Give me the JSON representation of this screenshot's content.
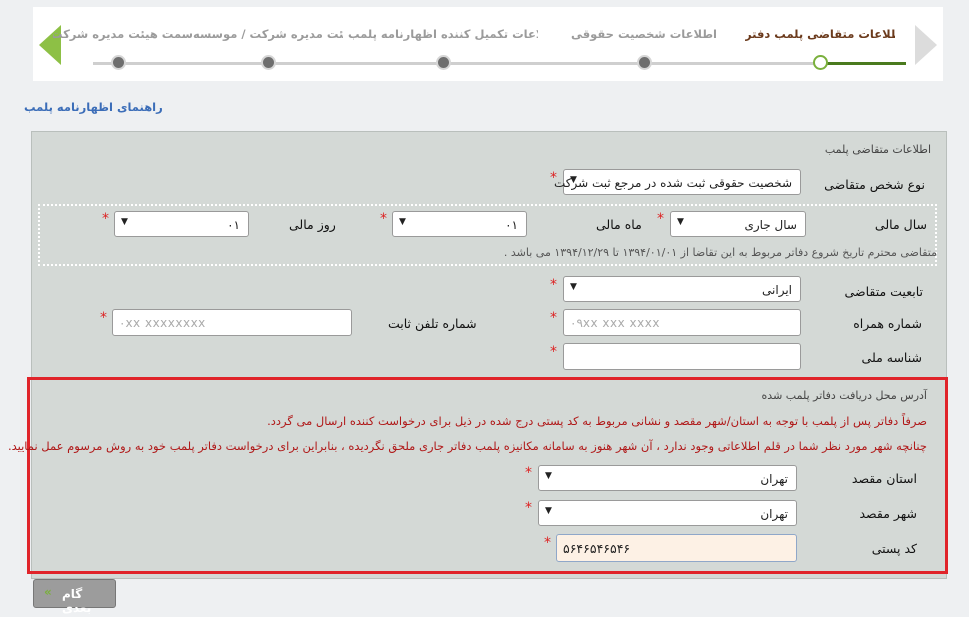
{
  "stepper": {
    "steps": [
      {
        "label": "اطلاعات متقاضی پلمب دفتر",
        "active": true
      },
      {
        "label": "اطلاعات شخصیت حقوقی",
        "active": false
      },
      {
        "label": "اطلاعات تکمیل کننده اظهارنامه پلمب",
        "active": false
      },
      {
        "label": "هیئت مدیره شرکت / موسسه",
        "active": false
      },
      {
        "label": "سمت هیئت مدیره شرکت / موسسه",
        "active": false
      }
    ]
  },
  "guide_link": "راهنمای اظهارنامه پلمب",
  "applicant": {
    "section_title": "اطلاعات متقاضی پلمب",
    "person_type": {
      "label": "نوع شخص متقاضی",
      "value": "شخصیت حقوقی ثبت شده در مرجع ثبت شرکت"
    },
    "fiscal_year": {
      "label": "سال مالی",
      "value": "سال جاری"
    },
    "fiscal_month": {
      "label": "ماه مالی",
      "value": "۰۱"
    },
    "fiscal_day": {
      "label": "روز مالی",
      "value": "۰۱"
    },
    "fiscal_note": "متقاضی محترم تاریخ شروع دفاتر مربوط به این تقاضا از ۱۳۹۴/۰۱/۰۱ تا ۱۳۹۴/۱۲/۲۹ می باشد .",
    "nationality": {
      "label": "تابعیت متقاضی",
      "value": "ایرانی"
    },
    "mobile": {
      "label": "شماره همراه",
      "placeholder": "۰۹xx xxx xxxx"
    },
    "landline": {
      "label": "شماره تلفن ثابت",
      "placeholder": "۰xx xxxxxxxx"
    },
    "national_id": {
      "label": "شناسه ملی",
      "value": ""
    }
  },
  "address": {
    "section_title": "آدرس محل دریافت دفاتر پلمب شده",
    "note1": "صرفاً دفاتر پس از پلمب با توجه به استان/شهر مقصد و نشانی مربوط به کد پستی درج شده در ذیل برای درخواست کننده ارسال می گردد.",
    "note2": "چنانچه شهر مورد نظر شما در قلم اطلاعاتی وجود ندارد ، آن شهر هنوز به سامانه مکانیزه پلمب دفاتر جاری ملحق نگردیده ، بنابراین برای درخواست دفاتر پلمب خود به روش مرسوم عمل نمایید.",
    "province": {
      "label": "استان مقصد",
      "value": "تهران"
    },
    "city": {
      "label": "شهر مقصد",
      "value": "تهران"
    },
    "postal_code": {
      "label": "کد پستی",
      "value": "۵۶۴۶۵۴۶۵۴۶"
    }
  },
  "required_mark": "*",
  "next_button": "گام بعدی",
  "colors": {
    "accent_green": "#7ab03c",
    "highlight_red": "#e0242a",
    "panel_bg": "#d4d9d6"
  }
}
